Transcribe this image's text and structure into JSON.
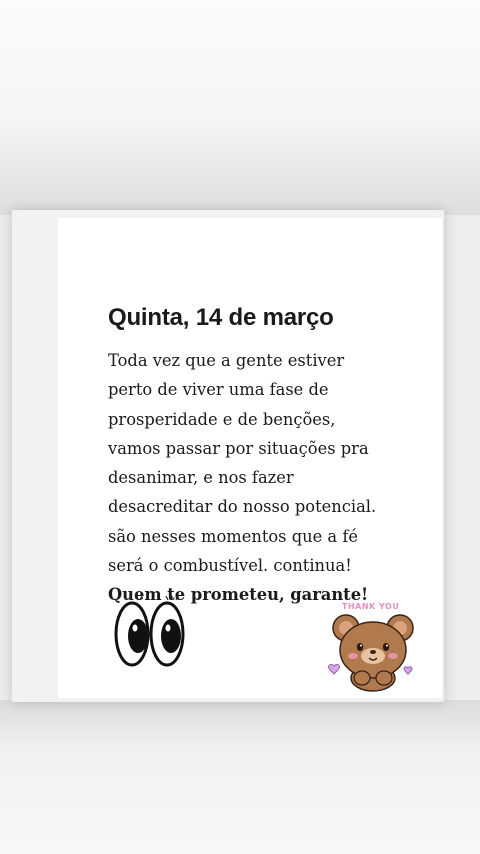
{
  "post": {
    "title": "Quinta, 14 de março",
    "lines": [
      "Toda vez que a gente estiver",
      "perto de viver uma fase de",
      "prosperidade e de benções,",
      "vamos passar por situações pra",
      "desanimar, e nos fazer",
      "desacreditar do nosso potencial.",
      "são nesses momentos que a fé",
      "será o combustível. continua!",
      "Quem te prometeu, garante!"
    ],
    "sticker_text": "THANK YOU"
  },
  "icons": [
    "eyes-icon",
    "bear-sticker-icon",
    "heart-icon"
  ],
  "colors": {
    "text": "#1a1a1a",
    "card": "#ffffff",
    "bear": "#b07a4e",
    "accent_pink": "#e58fc0"
  }
}
